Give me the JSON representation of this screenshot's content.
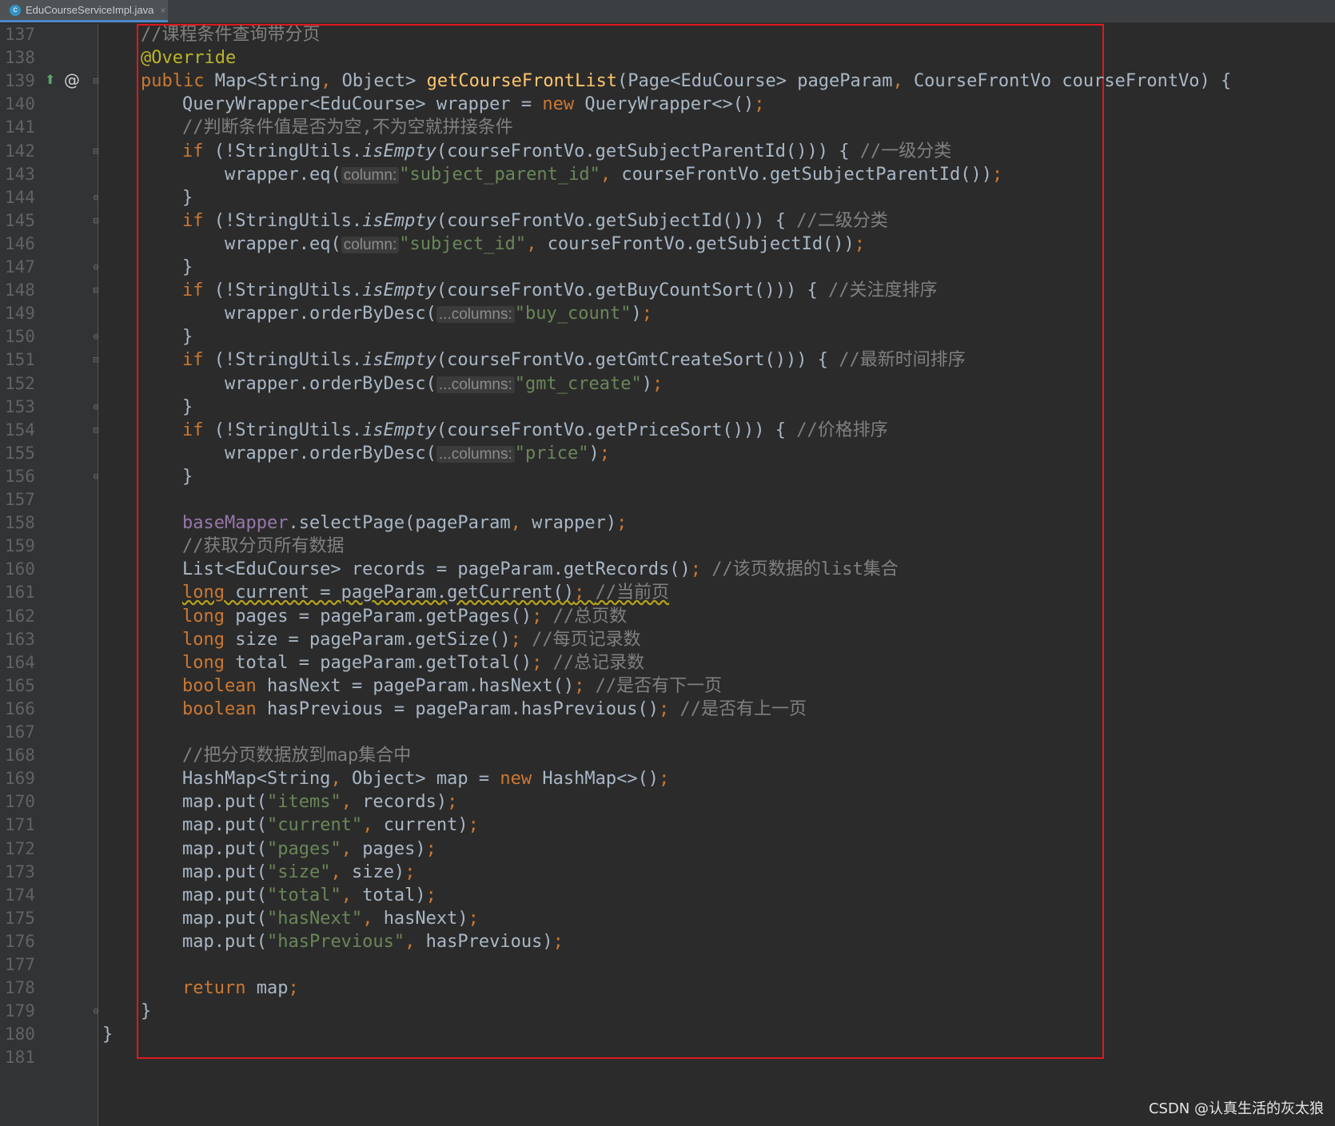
{
  "tab": {
    "filename": "EduCourseServiceImpl.java",
    "close": "×",
    "icon_letter": "c"
  },
  "watermark": "CSDN @认真生活的灰太狼",
  "lines": [
    {
      "n": "137",
      "i": 1,
      "parts": [
        [
          "cmt",
          "//课程条件查询带分页"
        ]
      ]
    },
    {
      "n": "138",
      "i": 1,
      "parts": [
        [
          "ann",
          "@Override"
        ]
      ]
    },
    {
      "n": "139",
      "i": 1,
      "parts": [
        [
          "kw",
          "public "
        ],
        [
          "",
          "Map<String"
        ],
        [
          "kw",
          ", "
        ],
        [
          "",
          "Object> "
        ],
        [
          "fn",
          "getCourseFrontList"
        ],
        [
          "",
          "(Page<EduCourse> pageParam"
        ],
        [
          "kw",
          ", "
        ],
        [
          "",
          "CourseFrontVo courseFrontVo) {"
        ]
      ]
    },
    {
      "n": "140",
      "i": 2,
      "parts": [
        [
          "",
          "QueryWrapper<EduCourse> wrapper = "
        ],
        [
          "kw",
          "new "
        ],
        [
          "",
          "QueryWrapper<>()"
        ],
        [
          "kw",
          ";"
        ]
      ]
    },
    {
      "n": "141",
      "i": 2,
      "parts": [
        [
          "cmt",
          "//判断条件值是否为空,不为空就拼接条件"
        ]
      ]
    },
    {
      "n": "142",
      "i": 2,
      "parts": [
        [
          "kw",
          "if "
        ],
        [
          "",
          "(!StringUtils."
        ],
        [
          "it",
          "isEmpty"
        ],
        [
          "",
          "(courseFrontVo.getSubjectParentId())) { "
        ],
        [
          "cmt",
          "//一级分类"
        ]
      ]
    },
    {
      "n": "143",
      "i": 3,
      "parts": [
        [
          "",
          "wrapper.eq("
        ],
        [
          "hint",
          "column:"
        ],
        [
          "str",
          "\"subject_parent_id\""
        ],
        [
          "kw",
          ", "
        ],
        [
          "",
          "courseFrontVo.getSubjectParentId())"
        ],
        [
          "kw",
          ";"
        ]
      ]
    },
    {
      "n": "144",
      "i": 2,
      "parts": [
        [
          "",
          "}"
        ]
      ]
    },
    {
      "n": "145",
      "i": 2,
      "parts": [
        [
          "kw",
          "if "
        ],
        [
          "",
          "(!StringUtils."
        ],
        [
          "it",
          "isEmpty"
        ],
        [
          "",
          "(courseFrontVo.getSubjectId())) { "
        ],
        [
          "cmt",
          "//二级分类"
        ]
      ]
    },
    {
      "n": "146",
      "i": 3,
      "parts": [
        [
          "",
          "wrapper.eq("
        ],
        [
          "hint",
          "column:"
        ],
        [
          "str",
          "\"subject_id\""
        ],
        [
          "kw",
          ", "
        ],
        [
          "",
          "courseFrontVo.getSubjectId())"
        ],
        [
          "kw",
          ";"
        ]
      ]
    },
    {
      "n": "147",
      "i": 2,
      "parts": [
        [
          "",
          "}"
        ]
      ]
    },
    {
      "n": "148",
      "i": 2,
      "parts": [
        [
          "kw",
          "if "
        ],
        [
          "",
          "(!StringUtils."
        ],
        [
          "it",
          "isEmpty"
        ],
        [
          "",
          "(courseFrontVo.getBuyCountSort())) { "
        ],
        [
          "cmt",
          "//关注度排序"
        ]
      ]
    },
    {
      "n": "149",
      "i": 3,
      "parts": [
        [
          "",
          "wrapper.orderByDesc("
        ],
        [
          "hint",
          "...columns:"
        ],
        [
          "str",
          "\"buy_count\""
        ],
        [
          "",
          ")"
        ],
        [
          "kw",
          ";"
        ]
      ]
    },
    {
      "n": "150",
      "i": 2,
      "parts": [
        [
          "",
          "}"
        ]
      ]
    },
    {
      "n": "151",
      "i": 2,
      "parts": [
        [
          "kw",
          "if "
        ],
        [
          "",
          "(!StringUtils."
        ],
        [
          "it",
          "isEmpty"
        ],
        [
          "",
          "(courseFrontVo.getGmtCreateSort())) { "
        ],
        [
          "cmt",
          "//最新时间排序"
        ]
      ]
    },
    {
      "n": "152",
      "i": 3,
      "parts": [
        [
          "",
          "wrapper.orderByDesc("
        ],
        [
          "hint",
          "...columns:"
        ],
        [
          "str",
          "\"gmt_create\""
        ],
        [
          "",
          ")"
        ],
        [
          "kw",
          ";"
        ]
      ]
    },
    {
      "n": "153",
      "i": 2,
      "parts": [
        [
          "",
          "}"
        ]
      ]
    },
    {
      "n": "154",
      "i": 2,
      "parts": [
        [
          "kw",
          "if "
        ],
        [
          "",
          "(!StringUtils."
        ],
        [
          "it",
          "isEmpty"
        ],
        [
          "",
          "(courseFrontVo.getPriceSort())) { "
        ],
        [
          "cmt",
          "//价格排序"
        ]
      ]
    },
    {
      "n": "155",
      "i": 3,
      "parts": [
        [
          "",
          "wrapper.orderByDesc("
        ],
        [
          "hint",
          "...columns:"
        ],
        [
          "str",
          "\"price\""
        ],
        [
          "",
          ")"
        ],
        [
          "kw",
          ";"
        ]
      ]
    },
    {
      "n": "156",
      "i": 2,
      "parts": [
        [
          "",
          "}"
        ]
      ]
    },
    {
      "n": "157",
      "i": 2,
      "parts": []
    },
    {
      "n": "158",
      "i": 2,
      "parts": [
        [
          "fld",
          "baseMapper"
        ],
        [
          "",
          ".selectPage(pageParam"
        ],
        [
          "kw",
          ", "
        ],
        [
          "",
          "wrapper)"
        ],
        [
          "kw",
          ";"
        ]
      ]
    },
    {
      "n": "159",
      "i": 2,
      "parts": [
        [
          "cmt",
          "//获取分页所有数据"
        ]
      ]
    },
    {
      "n": "160",
      "i": 2,
      "parts": [
        [
          "",
          "List<EduCourse> records = pageParam.getRecords()"
        ],
        [
          "kw",
          "; "
        ],
        [
          "cmt",
          "//该页数据的list集合"
        ]
      ]
    },
    {
      "n": "161",
      "i": 2,
      "parts": [
        [
          "kw squig",
          "long "
        ],
        [
          "squig",
          "current = pageParam.getCurrent()"
        ],
        [
          "kw squig",
          "; "
        ],
        [
          "cmt squig",
          "//当前页"
        ]
      ]
    },
    {
      "n": "162",
      "i": 2,
      "parts": [
        [
          "kw",
          "long "
        ],
        [
          "",
          "pages = pageParam.getPages()"
        ],
        [
          "kw",
          "; "
        ],
        [
          "cmt",
          "//总页数"
        ]
      ]
    },
    {
      "n": "163",
      "i": 2,
      "parts": [
        [
          "kw",
          "long "
        ],
        [
          "",
          "size = pageParam.getSize()"
        ],
        [
          "kw",
          "; "
        ],
        [
          "cmt",
          "//每页记录数"
        ]
      ]
    },
    {
      "n": "164",
      "i": 2,
      "parts": [
        [
          "kw",
          "long "
        ],
        [
          "",
          "total = pageParam.getTotal()"
        ],
        [
          "kw",
          "; "
        ],
        [
          "cmt",
          "//总记录数"
        ]
      ]
    },
    {
      "n": "165",
      "i": 2,
      "parts": [
        [
          "kw",
          "boolean "
        ],
        [
          "",
          "hasNext = pageParam.hasNext()"
        ],
        [
          "kw",
          "; "
        ],
        [
          "cmt",
          "//是否有下一页"
        ]
      ]
    },
    {
      "n": "166",
      "i": 2,
      "parts": [
        [
          "kw",
          "boolean "
        ],
        [
          "",
          "hasPrevious = pageParam.hasPrevious()"
        ],
        [
          "kw",
          "; "
        ],
        [
          "cmt",
          "//是否有上一页"
        ]
      ]
    },
    {
      "n": "167",
      "i": 2,
      "parts": []
    },
    {
      "n": "168",
      "i": 2,
      "parts": [
        [
          "cmt",
          "//把分页数据放到map集合中"
        ]
      ]
    },
    {
      "n": "169",
      "i": 2,
      "parts": [
        [
          "",
          "HashMap<String"
        ],
        [
          "kw",
          ", "
        ],
        [
          "",
          "Object> map = "
        ],
        [
          "kw",
          "new "
        ],
        [
          "",
          "HashMap<>()"
        ],
        [
          "kw",
          ";"
        ]
      ]
    },
    {
      "n": "170",
      "i": 2,
      "parts": [
        [
          "",
          "map.put("
        ],
        [
          "str",
          "\"items\""
        ],
        [
          "kw",
          ", "
        ],
        [
          "",
          "records)"
        ],
        [
          "kw",
          ";"
        ]
      ]
    },
    {
      "n": "171",
      "i": 2,
      "parts": [
        [
          "",
          "map.put("
        ],
        [
          "str",
          "\"current\""
        ],
        [
          "kw",
          ", "
        ],
        [
          "",
          "current)"
        ],
        [
          "kw",
          ";"
        ]
      ]
    },
    {
      "n": "172",
      "i": 2,
      "parts": [
        [
          "",
          "map.put("
        ],
        [
          "str",
          "\"pages\""
        ],
        [
          "kw",
          ", "
        ],
        [
          "",
          "pages)"
        ],
        [
          "kw",
          ";"
        ]
      ]
    },
    {
      "n": "173",
      "i": 2,
      "parts": [
        [
          "",
          "map.put("
        ],
        [
          "str",
          "\"size\""
        ],
        [
          "kw",
          ", "
        ],
        [
          "",
          "size)"
        ],
        [
          "kw",
          ";"
        ]
      ]
    },
    {
      "n": "174",
      "i": 2,
      "parts": [
        [
          "",
          "map.put("
        ],
        [
          "str",
          "\"total\""
        ],
        [
          "kw",
          ", "
        ],
        [
          "",
          "total)"
        ],
        [
          "kw",
          ";"
        ]
      ]
    },
    {
      "n": "175",
      "i": 2,
      "parts": [
        [
          "",
          "map.put("
        ],
        [
          "str",
          "\"hasNext\""
        ],
        [
          "kw",
          ", "
        ],
        [
          "",
          "hasNext)"
        ],
        [
          "kw",
          ";"
        ]
      ]
    },
    {
      "n": "176",
      "i": 2,
      "parts": [
        [
          "",
          "map.put("
        ],
        [
          "str",
          "\"hasPrevious\""
        ],
        [
          "kw",
          ", "
        ],
        [
          "",
          "hasPrevious)"
        ],
        [
          "kw",
          ";"
        ]
      ]
    },
    {
      "n": "177",
      "i": 2,
      "parts": []
    },
    {
      "n": "178",
      "i": 2,
      "parts": [
        [
          "kw",
          "return "
        ],
        [
          "",
          "map"
        ],
        [
          "kw",
          ";"
        ]
      ]
    },
    {
      "n": "179",
      "i": 1,
      "parts": [
        [
          "",
          "}"
        ]
      ]
    },
    {
      "n": "180",
      "i": 0,
      "parts": [
        [
          "",
          "}"
        ]
      ]
    },
    {
      "n": "181",
      "i": 0,
      "parts": []
    }
  ],
  "fold_open_lines": [
    "139",
    "142",
    "145",
    "148",
    "151",
    "154"
  ],
  "fold_close_lines": [
    "144",
    "147",
    "150",
    "153",
    "156",
    "179"
  ],
  "gutter_icons": {
    "override_line": "139",
    "override_icon": "override-up-arrow-icon",
    "at_icon": "at-sign-icon"
  },
  "colors": {
    "background": "#2b2b2b",
    "keyword": "#cc7832",
    "string": "#6a8759",
    "comment": "#808080",
    "annotation": "#bbb529",
    "method_declaration": "#ffc66d",
    "field": "#9876aa",
    "highlight_box": "#e0191f"
  }
}
